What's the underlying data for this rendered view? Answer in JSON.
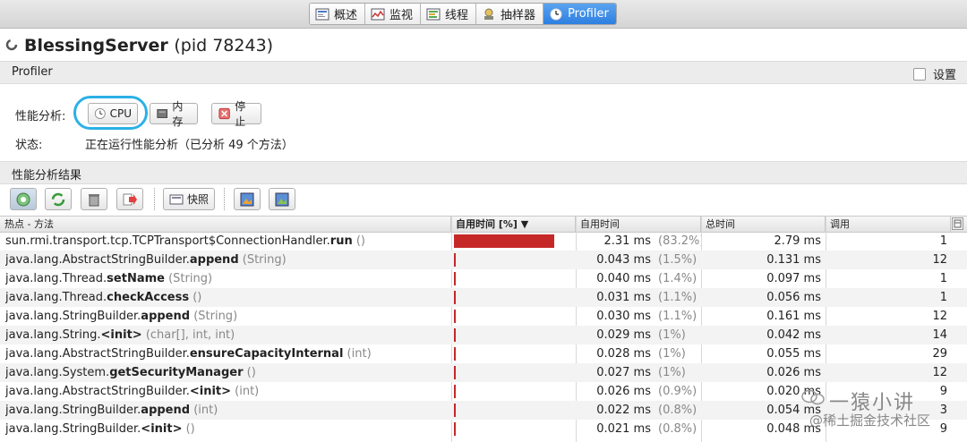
{
  "tabs": [
    {
      "label": "概述",
      "icon": "overview-icon"
    },
    {
      "label": "监视",
      "icon": "monitor-icon"
    },
    {
      "label": "线程",
      "icon": "threads-icon"
    },
    {
      "label": "抽样器",
      "icon": "sampler-icon"
    },
    {
      "label": "Profiler",
      "icon": "profiler-icon",
      "active": true
    }
  ],
  "app": {
    "name": "BlessingServer",
    "pid": "(pid 78243)"
  },
  "profiler_section": {
    "label": "Profiler",
    "settings_label": "设置"
  },
  "controls": {
    "analysis_label": "性能分析:",
    "cpu_label": "CPU",
    "memory_label": "内存",
    "stop_label": "停止",
    "status_label": "状态:",
    "status_text": "正在运行性能分析（已分析 49 个方法）"
  },
  "results_section": {
    "label": "性能分析结果",
    "snapshot_label": "快照"
  },
  "table": {
    "columns": [
      "热点 - 方法",
      "自用时间 [%] ▼",
      "自用时间",
      "总时间",
      "调用"
    ],
    "rows": [
      {
        "cls": "sun.rmi.transport.tcp.TCPTransport$ConnectionHandler.",
        "method": "run",
        "args": " ()",
        "self_pct": 83.2,
        "self_ms": "2.31 ms",
        "self_pct_text": "(83.2%)",
        "total": "2.79 ms",
        "calls": "1"
      },
      {
        "cls": "java.lang.AbstractStringBuilder.",
        "method": "append",
        "args": " (String)",
        "self_pct": 1.5,
        "self_ms": "0.043 ms",
        "self_pct_text": "(1.5%)",
        "total": "0.131 ms",
        "calls": "12"
      },
      {
        "cls": "java.lang.Thread.",
        "method": "setName",
        "args": " (String)",
        "self_pct": 1.4,
        "self_ms": "0.040 ms",
        "self_pct_text": "(1.4%)",
        "total": "0.097 ms",
        "calls": "1"
      },
      {
        "cls": "java.lang.Thread.",
        "method": "checkAccess",
        "args": " ()",
        "self_pct": 1.1,
        "self_ms": "0.031 ms",
        "self_pct_text": "(1.1%)",
        "total": "0.056 ms",
        "calls": "1"
      },
      {
        "cls": "java.lang.StringBuilder.",
        "method": "append",
        "args": " (String)",
        "self_pct": 1.1,
        "self_ms": "0.030 ms",
        "self_pct_text": "(1.1%)",
        "total": "0.161 ms",
        "calls": "12"
      },
      {
        "cls": "java.lang.String.",
        "method": "<init>",
        "args": " (char[], int, int)",
        "self_pct": 1.0,
        "self_ms": "0.029 ms",
        "self_pct_text": "(1%)",
        "total": "0.042 ms",
        "calls": "14"
      },
      {
        "cls": "java.lang.AbstractStringBuilder.",
        "method": "ensureCapacityInternal",
        "args": " (int)",
        "self_pct": 1.0,
        "self_ms": "0.028 ms",
        "self_pct_text": "(1%)",
        "total": "0.055 ms",
        "calls": "29"
      },
      {
        "cls": "java.lang.System.",
        "method": "getSecurityManager",
        "args": " ()",
        "self_pct": 1.0,
        "self_ms": "0.027 ms",
        "self_pct_text": "(1%)",
        "total": "0.026 ms",
        "calls": "12"
      },
      {
        "cls": "java.lang.AbstractStringBuilder.",
        "method": "<init>",
        "args": " (int)",
        "self_pct": 0.9,
        "self_ms": "0.026 ms",
        "self_pct_text": "(0.9%)",
        "total": "0.020 ms",
        "calls": "9"
      },
      {
        "cls": "java.lang.StringBuilder.",
        "method": "append",
        "args": " (int)",
        "self_pct": 0.8,
        "self_ms": "0.022 ms",
        "self_pct_text": "(0.8%)",
        "total": "0.054 ms",
        "calls": "3"
      },
      {
        "cls": "java.lang.StringBuilder.",
        "method": "<init>",
        "args": " ()",
        "self_pct": 0.8,
        "self_ms": "0.021 ms",
        "self_pct_text": "(0.8%)",
        "total": "0.048 ms",
        "calls": "9"
      }
    ]
  },
  "watermark": {
    "title": "一猿小讲",
    "subtitle": "@稀土掘金技术社区"
  },
  "colors": {
    "accent": "#2d7fe0",
    "bar": "#c62828",
    "highlight": "#2ab0e6"
  }
}
